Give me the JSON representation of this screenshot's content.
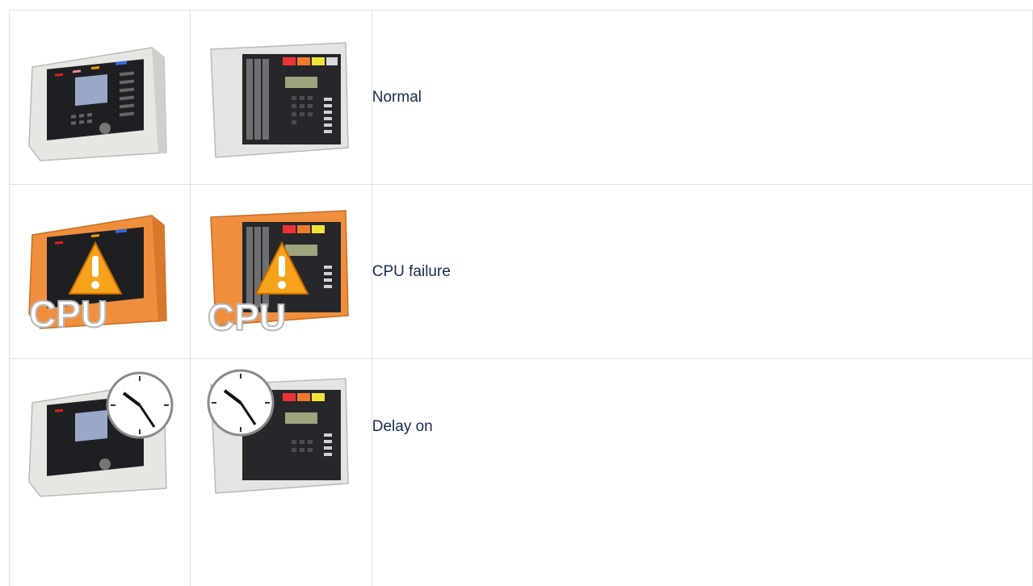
{
  "table": {
    "rows": [
      {
        "state": "normal",
        "label": "Normal",
        "overlay": "none",
        "housing_color": "#e4e5e2"
      },
      {
        "state": "cpu-failure",
        "label": "CPU failure",
        "overlay": "cpu-warning",
        "housing_color": "#ef8f3e",
        "overlay_text": "CPU"
      },
      {
        "state": "delay-on",
        "label": "Delay on",
        "overlay": "clock",
        "housing_color": "#e4e5e2"
      }
    ]
  },
  "colors": {
    "border": "#dfe1e5",
    "text": "#172b4d",
    "warning": "#f7a21b",
    "orange_housing": "#ef8f3e",
    "grey_housing": "#e4e5e2"
  },
  "icons": {
    "panel_a": "fire-panel-touchscreen-icon",
    "panel_b": "fire-panel-keypad-icon",
    "warning": "warning-triangle-icon",
    "clock": "clock-icon"
  }
}
